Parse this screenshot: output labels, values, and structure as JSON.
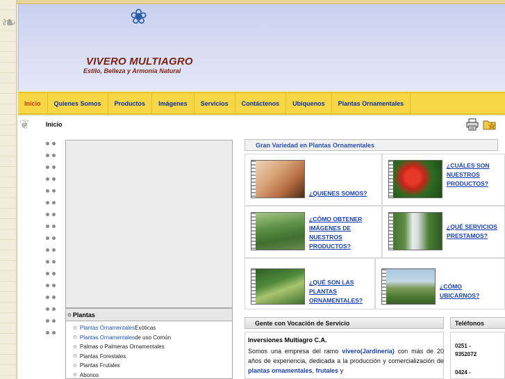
{
  "site": {
    "title": "VIVERO MULTIAGRO",
    "subtitle": "Estilo, Belleza y Armonía Natural"
  },
  "nav": {
    "items": [
      {
        "label": "Inicio",
        "active": true
      },
      {
        "label": "Quienes Somos"
      },
      {
        "label": "Productos"
      },
      {
        "label": "Imágenes"
      },
      {
        "label": "Servicios"
      },
      {
        "label": "Contáctenos"
      },
      {
        "label": "Ubiquenos"
      },
      {
        "label": "Plantas Ornamentales"
      }
    ]
  },
  "breadcrumb": "Inicio",
  "icons": {
    "print": "print-icon",
    "favorites": "favorites-folder-icon",
    "logo": "flower-logo-icon"
  },
  "plantas": {
    "heading": "Plantas",
    "items": [
      {
        "link": "Plantas Ornamentales",
        "rest": " Exóticas"
      },
      {
        "link": "Plantas Ornamentales",
        "rest": " de uso Común"
      },
      {
        "link": "",
        "rest": "Palmas o Palmeras Ornamentales"
      },
      {
        "link": "",
        "rest": "Plantas Forestales"
      },
      {
        "link": "",
        "rest": "Plantas Frutales"
      },
      {
        "link": "",
        "rest": "Abonos"
      }
    ]
  },
  "gran_variedad": "Gran Variedad en Plantas Ornamentales",
  "grid": [
    {
      "label": "¿QUIENES SOMOS?"
    },
    {
      "label": "¿CUÁLES SON NUESTROS PRODUCTOS?"
    },
    {
      "label": "¿CÓMO OBTENER IMÁGENES DE NUESTROS PRODUCTOS?"
    },
    {
      "label": "¿QUÉ SERVICIOS PRESTAMOS?"
    },
    {
      "label": "¿QUÉ SON LAS PLANTAS ORNAMENTALES?"
    },
    {
      "label": "¿CÓMO UBICARNOS?"
    }
  ],
  "gente": {
    "heading": "Gente con Vocación de Servicio",
    "company": "Inversiones Multiagro C.A.",
    "text_1": "Somos una empresa del ramo ",
    "hl_1": "vivero(Jardinería)",
    "text_2": " con más de 20 años de experiencia, dedicada a la producción y comercialización de ",
    "hl_2": "plantas ornamentales",
    "text_3": ", ",
    "hl_3": "frutales",
    "text_4": " y"
  },
  "telefonos": {
    "heading": "Teléfonos",
    "phone_1a": "0251 -",
    "phone_1b": "9352072",
    "phone_2a": "0424 -"
  },
  "colors": {
    "nav_bg": "#f5d645",
    "nav_link": "#0d2fa8",
    "active": "#d23b00",
    "title": "#7b1f10"
  }
}
